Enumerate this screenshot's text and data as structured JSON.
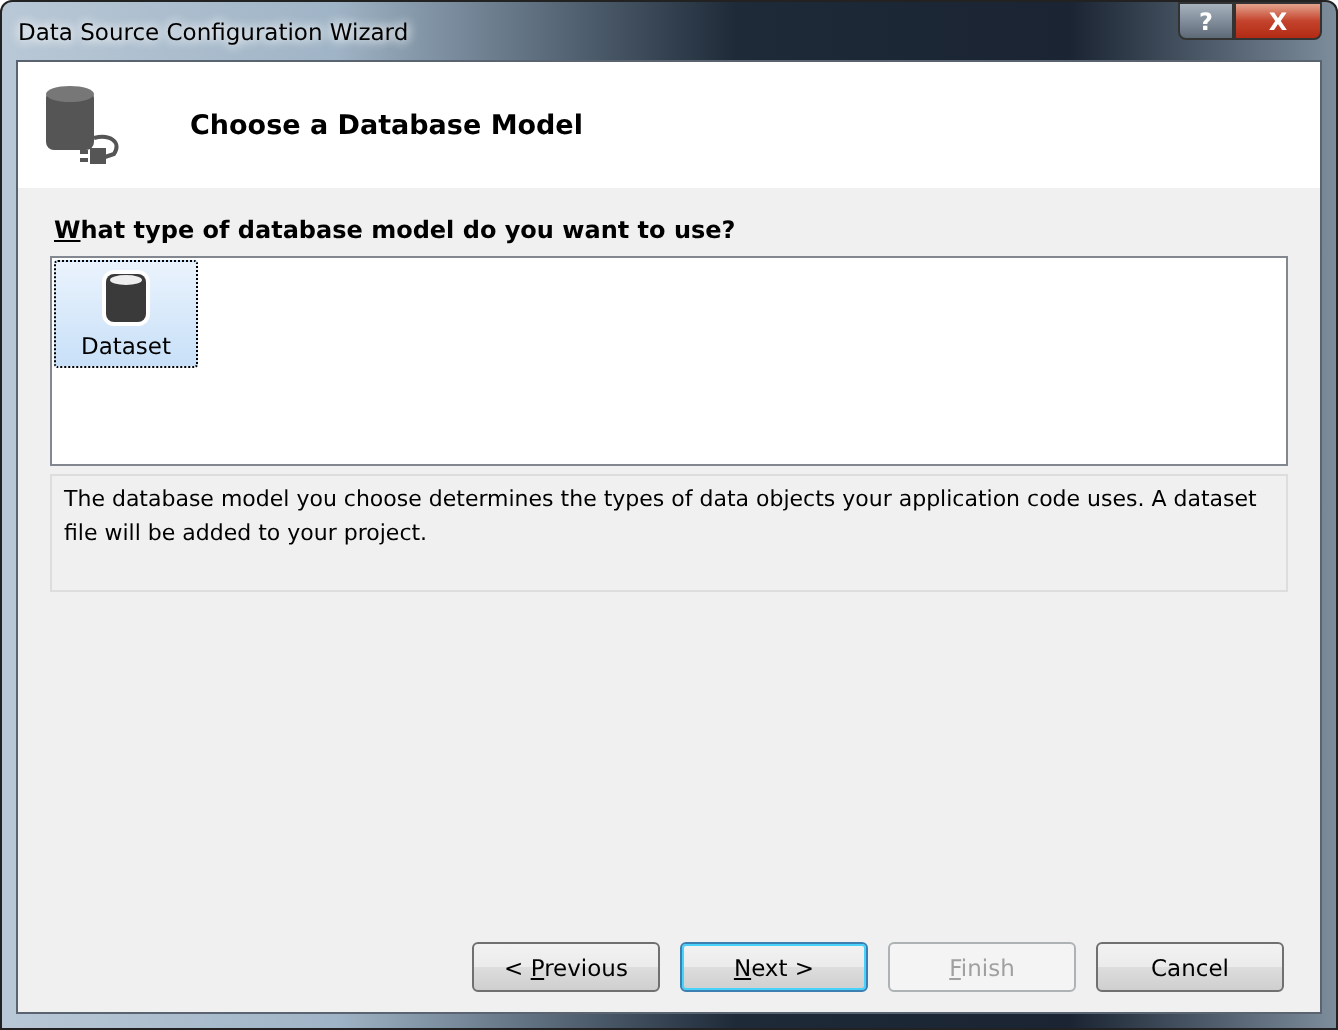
{
  "window": {
    "title": "Data Source Configuration Wizard",
    "controls": [
      {
        "kind": "help",
        "label": "?"
      },
      {
        "kind": "close",
        "label": "X"
      }
    ]
  },
  "header": {
    "title": "Choose a Database Model"
  },
  "question": {
    "access_key": "W",
    "label_rest": "hat type of database model do you want to use?"
  },
  "models": [
    {
      "label": "Dataset",
      "selected": true
    }
  ],
  "description": "The database model you choose determines the types of data objects your application code uses. A dataset file will be added to your project.",
  "buttons": [
    {
      "label_start": "< ",
      "access_key": "P",
      "label_rest": "revious",
      "default": false,
      "disabled": false
    },
    {
      "access_key": "N",
      "label_rest": "ext >",
      "default": true,
      "disabled": false
    },
    {
      "access_key": "F",
      "label_rest": "inish",
      "default": false,
      "disabled": true
    },
    {
      "label_rest": "Cancel",
      "default": false,
      "disabled": false
    }
  ]
}
